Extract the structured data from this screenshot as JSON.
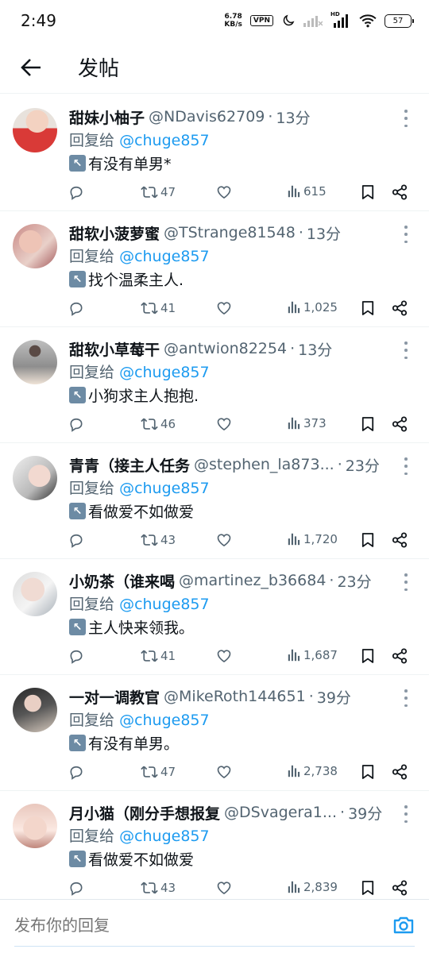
{
  "status_bar": {
    "time": "2:49",
    "net_speed_value": "6.78",
    "net_speed_unit": "KB/s",
    "vpn": "VPN",
    "signal_label": "HD",
    "battery": "57"
  },
  "header": {
    "title": "发帖"
  },
  "reply_prefix": "回复给",
  "tweets": [
    {
      "name": "甜妹小柚子",
      "handle": "@NDavis62709",
      "time": "13分",
      "reply_to": "@chuge857",
      "text": "有没有单男*",
      "retweets": "47",
      "views": "615"
    },
    {
      "name": "甜软小菠萝蜜",
      "handle": "@TStrange81548",
      "time": "13分",
      "reply_to": "@chuge857",
      "text": "找个温柔主人.",
      "retweets": "41",
      "views": "1,025"
    },
    {
      "name": "甜软小草莓干",
      "handle": "@antwion82254",
      "time": "13分",
      "reply_to": "@chuge857",
      "text": "小狗求主人抱抱.",
      "retweets": "46",
      "views": "373"
    },
    {
      "name": "青青（接主人任务",
      "handle": "@stephen_la873...",
      "time": "23分",
      "reply_to": "@chuge857",
      "text": "看做爱不如做爱",
      "retweets": "43",
      "views": "1,720"
    },
    {
      "name": "小奶茶（谁来喝",
      "handle": "@martinez_b36684",
      "time": "23分",
      "reply_to": "@chuge857",
      "text": "主人快来领我。",
      "retweets": "41",
      "views": "1,687"
    },
    {
      "name": "一对一调教官",
      "handle": "@MikeRoth144651",
      "time": "39分",
      "reply_to": "@chuge857",
      "text": "有没有单男。",
      "retweets": "47",
      "views": "2,738"
    },
    {
      "name": "月小猫（刚分手想报复",
      "handle": "@DSvagera1...",
      "time": "39分",
      "reply_to": "@chuge857",
      "text": "看做爱不如做爱",
      "retweets": "43",
      "views": "2,839"
    }
  ],
  "composer": {
    "placeholder": "发布你的回复"
  },
  "icons": {
    "back": "arrow-left-icon",
    "more": "more-vertical-icon",
    "reply": "reply-bubble-icon",
    "retweet": "retweet-icon",
    "like": "heart-icon",
    "views": "analytics-icon",
    "bookmark": "bookmark-icon",
    "share": "share-icon",
    "camera": "camera-icon",
    "arrow_emoji": "up-left-arrow-emoji"
  },
  "colors": {
    "link": "#1d9bf0",
    "secondary_text": "#536471",
    "primary_text": "#0f1419"
  }
}
